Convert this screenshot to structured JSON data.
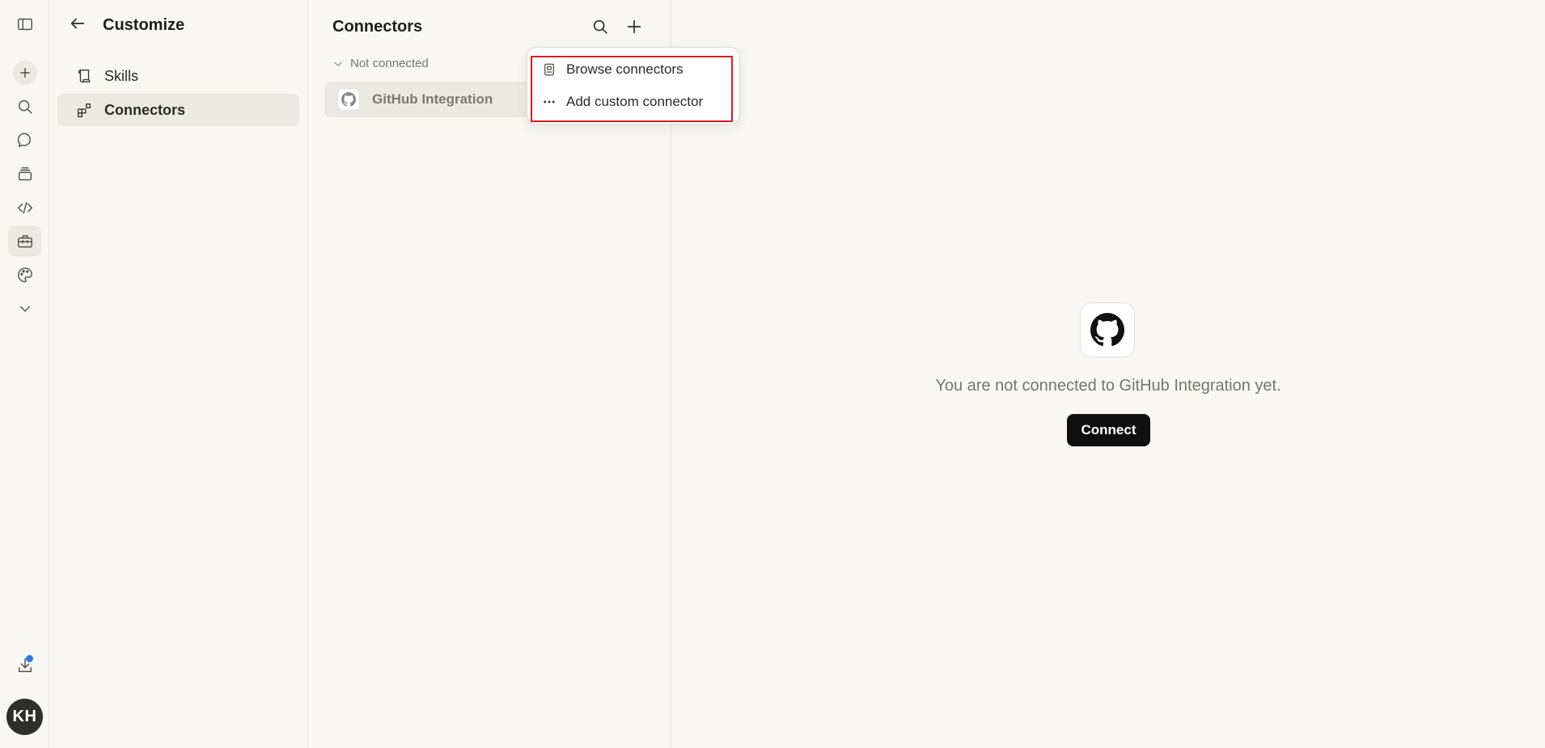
{
  "rail": {
    "icons": [
      "sidebar-toggle-icon",
      "new-chat-icon",
      "search-icon",
      "chats-icon",
      "projects-icon",
      "code-icon",
      "customize-toolbox-icon",
      "palette-icon",
      "chevron-down-icon",
      "download-icon"
    ],
    "active": "customize-toolbox-icon",
    "avatar_initials": "KH",
    "notification_dot_color": "#2f7be5"
  },
  "customize": {
    "title": "Customize",
    "nav": [
      {
        "label": "Skills",
        "icon": "scroll-icon",
        "active": false
      },
      {
        "label": "Connectors",
        "icon": "connectors-grid-icon",
        "active": true
      }
    ]
  },
  "connectors": {
    "title": "Connectors",
    "group_label": "Not connected",
    "items": [
      {
        "label": "GitHub Integration",
        "icon": "github-icon"
      }
    ]
  },
  "add_menu": {
    "items": [
      {
        "label": "Browse connectors",
        "icon": "book-icon"
      },
      {
        "label": "Add custom connector",
        "icon": "dots-icon"
      }
    ],
    "highlight_color": "#e01b1b"
  },
  "detail": {
    "message": "You are not connected to GitHub Integration yet.",
    "connect_label": "Connect"
  }
}
